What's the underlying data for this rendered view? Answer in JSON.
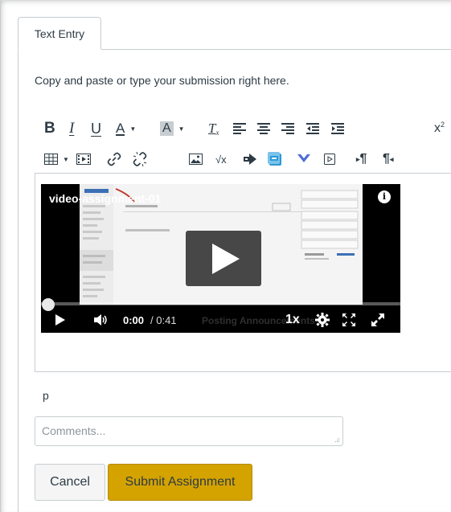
{
  "tabs": [
    {
      "label": "Text Entry"
    }
  ],
  "instructions": "Copy and paste or type your submission right here.",
  "toolbar": {
    "row1": [
      {
        "name": "bold-icon",
        "glyph": "B"
      },
      {
        "name": "italic-icon",
        "glyph": "I"
      },
      {
        "name": "underline-icon",
        "glyph": "U"
      },
      {
        "name": "text-color-icon",
        "glyph": "A"
      },
      {
        "name": "background-color-icon",
        "glyph": "A"
      },
      {
        "name": "clear-formatting-icon",
        "glyph": "Tx"
      },
      {
        "name": "align-left-icon"
      },
      {
        "name": "align-center-icon"
      },
      {
        "name": "align-right-icon"
      },
      {
        "name": "outdent-icon"
      },
      {
        "name": "indent-icon"
      },
      {
        "name": "superscript-icon",
        "glyph": "x²"
      }
    ],
    "row2": [
      {
        "name": "table-icon"
      },
      {
        "name": "media-icon"
      },
      {
        "name": "link-icon"
      },
      {
        "name": "unlink-icon"
      },
      {
        "name": "image-icon"
      },
      {
        "name": "equation-icon",
        "glyph": "√x"
      },
      {
        "name": "embed-icon"
      },
      {
        "name": "office-icon"
      },
      {
        "name": "dropdown-chevron-icon"
      },
      {
        "name": "record-media-icon"
      },
      {
        "name": "ltr-paragraph-icon",
        "glyph": "¶"
      },
      {
        "name": "rtl-paragraph-icon",
        "glyph": "¶"
      }
    ]
  },
  "video": {
    "title": "video-assignment-01",
    "current_time": "0:00",
    "duration": "/ 0:41",
    "speed": "1x",
    "progress": 0,
    "faint_caption": "Posting Announcements"
  },
  "editor_path": "p",
  "comments": {
    "placeholder": "Comments..."
  },
  "buttons": {
    "cancel": "Cancel",
    "submit": "Submit Assignment"
  },
  "colors": {
    "submit": "#d4a300",
    "border": "#c7cdd1",
    "text": "#2d3b45",
    "office_icon": "#2b9ad6",
    "chevron_icon": "#4f6bd9"
  }
}
